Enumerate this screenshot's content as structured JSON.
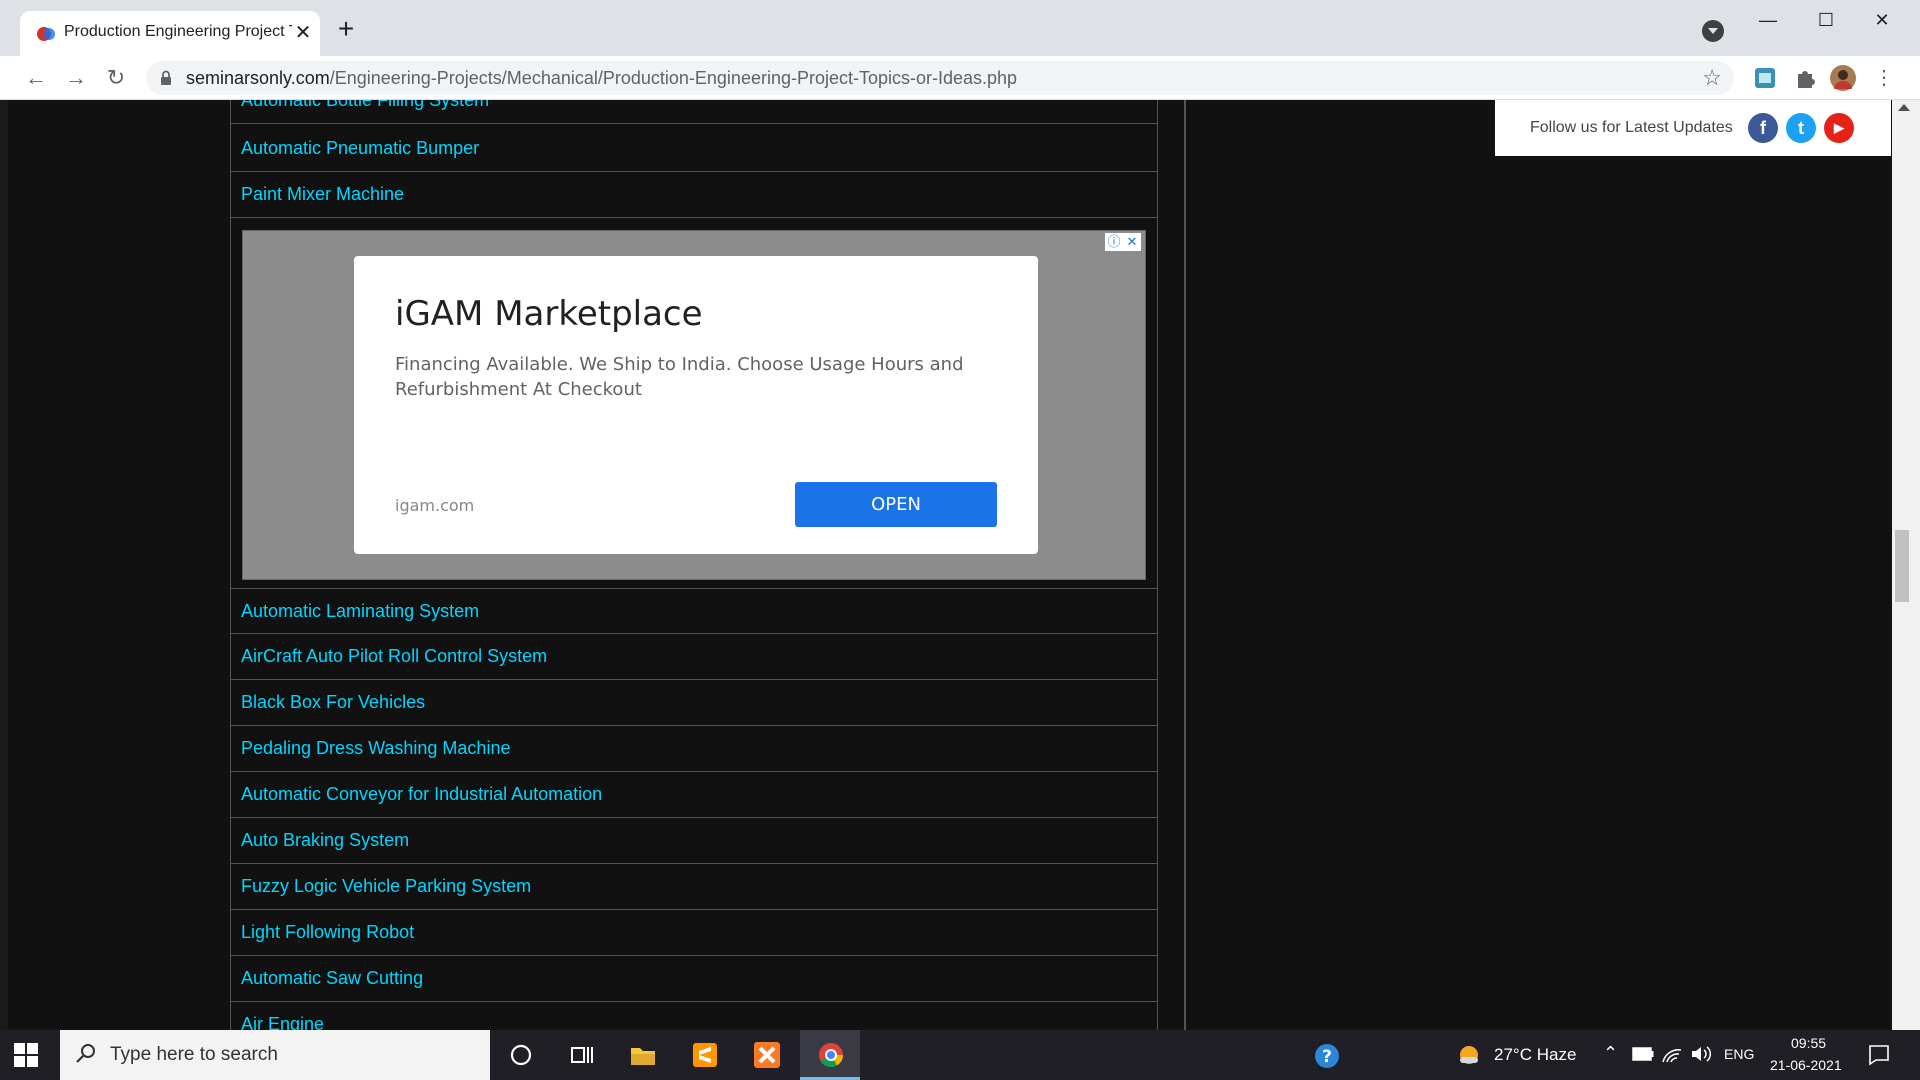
{
  "browser": {
    "tab_title": "Production Engineering Project T",
    "new_tab": "+",
    "url_host": "seminarsonly.com",
    "url_path": "/Engineering-Projects/Mechanical/Production-Engineering-Project-Topics-or-Ideas.php"
  },
  "topics_before_ad": [
    "Automatic Bottle Filling System",
    "Automatic Pneumatic Bumper",
    "Paint Mixer Machine"
  ],
  "ad": {
    "title": "iGAM Marketplace",
    "text": "Financing Available. We Ship to India. Choose Usage Hours and Refurbishment At Checkout",
    "domain": "igam.com",
    "button": "OPEN"
  },
  "topics_after_ad": [
    "Automatic Laminating System",
    "AirCraft Auto Pilot Roll Control System",
    "Black Box For Vehicles",
    "Pedaling Dress Washing Machine",
    "Automatic Conveyor for Industrial Automation",
    "Auto Braking System",
    "Fuzzy Logic Vehicle Parking System",
    "Light Following Robot",
    "Automatic Saw Cutting",
    "Air Engine"
  ],
  "follow": {
    "text": "Follow us for Latest Updates",
    "facebook": "f",
    "twitter": "t",
    "youtube": "▶"
  },
  "taskbar": {
    "search_placeholder": "Type here to search",
    "weather": "27°C  Haze",
    "language": "ENG",
    "time": "09:55",
    "date": "21-06-2021"
  },
  "colors": {
    "link": "#00d7ff",
    "page_bg": "#111111",
    "ad_button": "#1a73e8",
    "facebook": "#3b5998",
    "twitter": "#1da1f2",
    "youtube": "#e62117"
  }
}
